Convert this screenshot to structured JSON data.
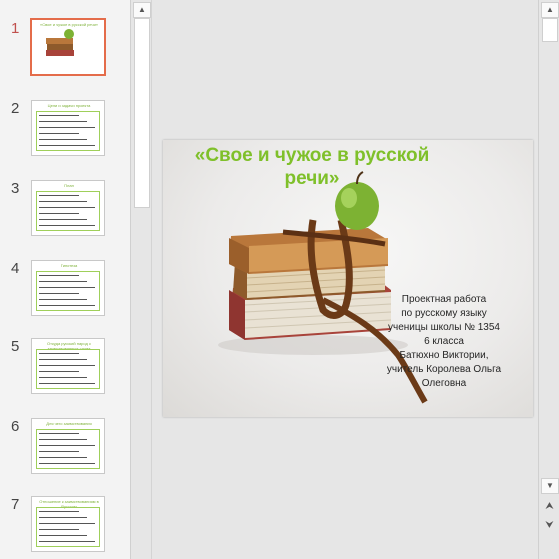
{
  "thumbnails": [
    {
      "num": "1",
      "title": "«Свое и чужое в русской речи»",
      "active": true
    },
    {
      "num": "2",
      "title": "Цели и задачи проекта",
      "active": false
    },
    {
      "num": "3",
      "title": "План",
      "active": false
    },
    {
      "num": "4",
      "title": "Гипотеза",
      "active": false
    },
    {
      "num": "5",
      "title": "Откуда русский народ с заимствованные слова",
      "active": false
    },
    {
      "num": "6",
      "title": "Для чего заимствования",
      "active": false
    },
    {
      "num": "7",
      "title": "Отношение к заимствованиям в Русском",
      "active": false
    }
  ],
  "slide": {
    "title_line1": "«Свое и чужое в русской",
    "title_line2": "речи»",
    "subtitle": [
      "Проектная работа",
      "по русскому языку",
      "ученицы школы № 1354",
      "6 класса",
      "Батюхно Виктории,",
      "учитель Королева Ольга",
      "Олеговна"
    ]
  },
  "scrollbar": {
    "up": "▲",
    "down": "▼",
    "prev_slide": "⮝",
    "next_slide": "⮟"
  },
  "colors": {
    "title_green": "#7fc02a",
    "active_border": "#e46c4a",
    "active_number": "#c0504d"
  }
}
